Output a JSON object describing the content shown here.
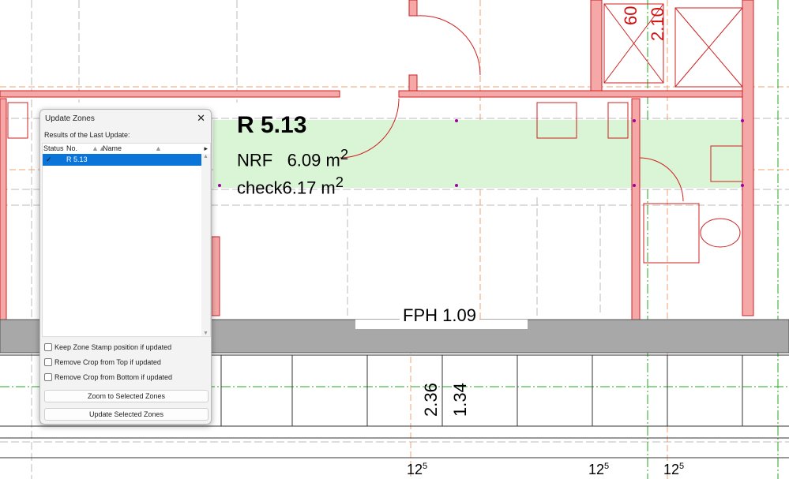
{
  "drawing": {
    "zone_number": "R 5.13",
    "zone_nrf_label": "NRF",
    "zone_nrf_value": "6.09 m",
    "zone_check_label": "check",
    "zone_check_value": "6.17 m",
    "area_exponent": "2",
    "fph_label": "FPH 1.09",
    "dim_vertical_1": "2.36",
    "dim_vertical_2": "1.34",
    "dim_red_1": "60",
    "dim_red_2": "2.10",
    "dim_bottom": [
      "12",
      "12",
      "12"
    ],
    "dim_bottom_exp": "5",
    "zone_fill_color": "#d9f5d5",
    "wall_color": "#f4a8a8"
  },
  "dialog": {
    "title": "Update Zones",
    "close_icon": "close-icon",
    "results_label": "Results of the Last Update:",
    "columns": [
      "Status",
      "No.",
      "Name"
    ],
    "rows": [
      {
        "status": "✓",
        "no": "R 5.13",
        "name": ""
      }
    ],
    "checkboxes": [
      {
        "label": "Keep Zone Stamp position if updated",
        "checked": false
      },
      {
        "label": "Remove Crop from Top if updated",
        "checked": false
      },
      {
        "label": "Remove Crop from Bottom if updated",
        "checked": false
      }
    ],
    "zoom_button": "Zoom to Selected Zones",
    "update_button": "Update Selected Zones"
  }
}
